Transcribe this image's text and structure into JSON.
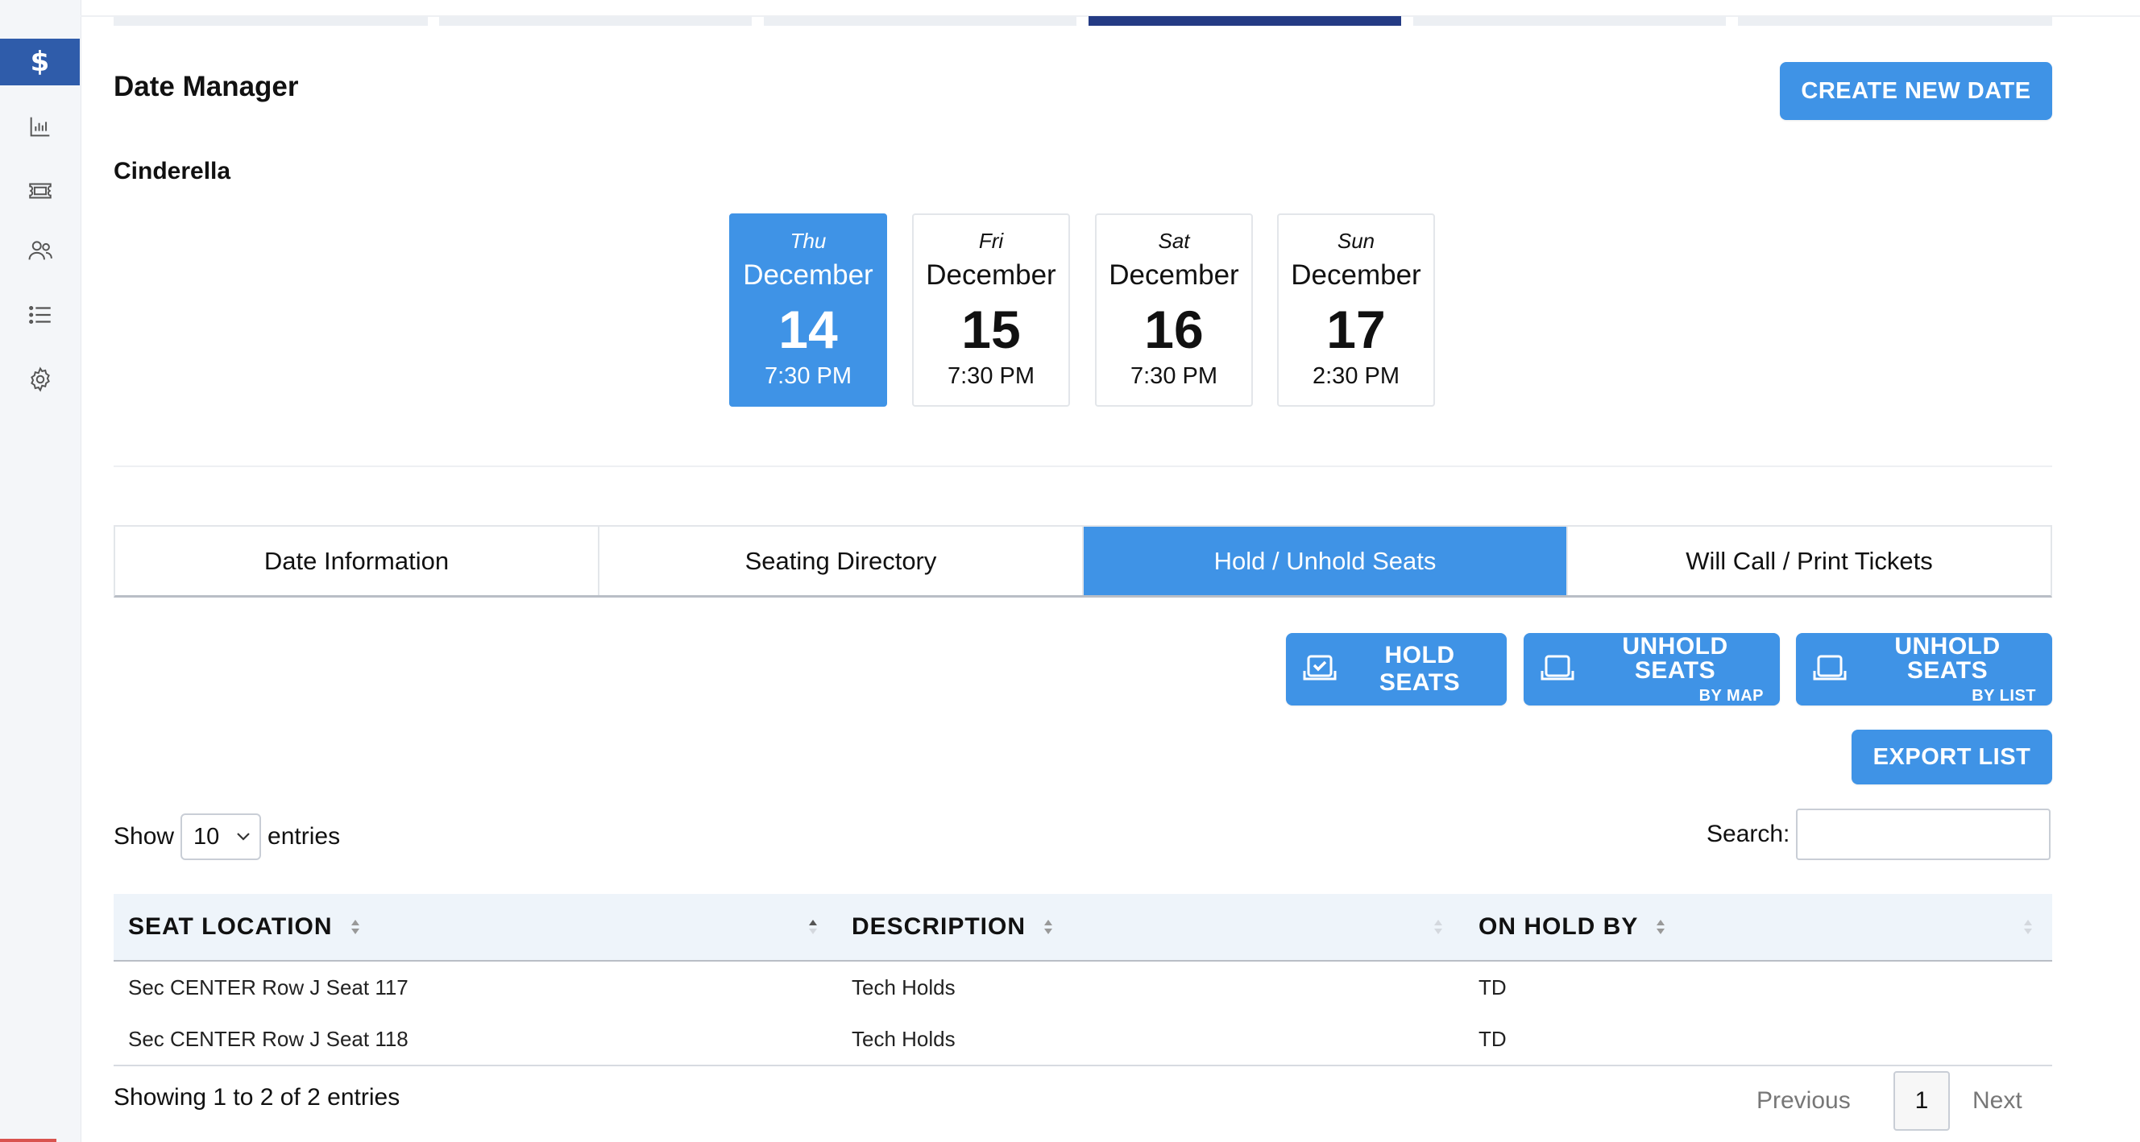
{
  "sidebar": {
    "dollar_symbol": "$",
    "items": [
      {
        "icon": "dollar-icon",
        "active": true
      },
      {
        "icon": "bar-chart-icon"
      },
      {
        "icon": "ticket-icon"
      },
      {
        "icon": "users-icon"
      },
      {
        "icon": "list-icon"
      },
      {
        "icon": "gear-icon"
      }
    ]
  },
  "header": {
    "title": "Date Manager",
    "create_button": "CREATE NEW DATE",
    "show_name": "Cinderella"
  },
  "dates": [
    {
      "day": "Thu",
      "month": "December",
      "num": "14",
      "time": "7:30 PM",
      "active": true
    },
    {
      "day": "Fri",
      "month": "December",
      "num": "15",
      "time": "7:30 PM"
    },
    {
      "day": "Sat",
      "month": "December",
      "num": "16",
      "time": "7:30 PM"
    },
    {
      "day": "Sun",
      "month": "December",
      "num": "17",
      "time": "2:30 PM"
    }
  ],
  "tabs": [
    {
      "label": "Date Information"
    },
    {
      "label": "Seating Directory"
    },
    {
      "label": "Hold / Unhold Seats",
      "active": true
    },
    {
      "label": "Will Call / Print Tickets"
    }
  ],
  "actions": {
    "hold": "HOLD SEATS",
    "unhold_map": "UNHOLD SEATS",
    "unhold_map_sub": "BY MAP",
    "unhold_list": "UNHOLD SEATS",
    "unhold_list_sub": "BY LIST",
    "export": "EXPORT LIST"
  },
  "table_controls": {
    "show_label": "Show",
    "entries_value": "10",
    "entries_label": "entries",
    "search_label": "Search:",
    "search_value": ""
  },
  "table": {
    "columns": [
      "SEAT LOCATION",
      "DESCRIPTION",
      "ON HOLD BY"
    ],
    "rows": [
      [
        "Sec CENTER Row J Seat 117",
        "Tech Holds",
        "TD"
      ],
      [
        "Sec CENTER Row J Seat 118",
        "Tech Holds",
        "TD"
      ]
    ],
    "info": "Showing 1 to 2 of 2 entries"
  },
  "pagination": {
    "previous": "Previous",
    "page": "1",
    "next": "Next"
  },
  "colors": {
    "primary": "#3f93e6",
    "sidebar_active": "#2f5caa",
    "step_active": "#243b84"
  }
}
